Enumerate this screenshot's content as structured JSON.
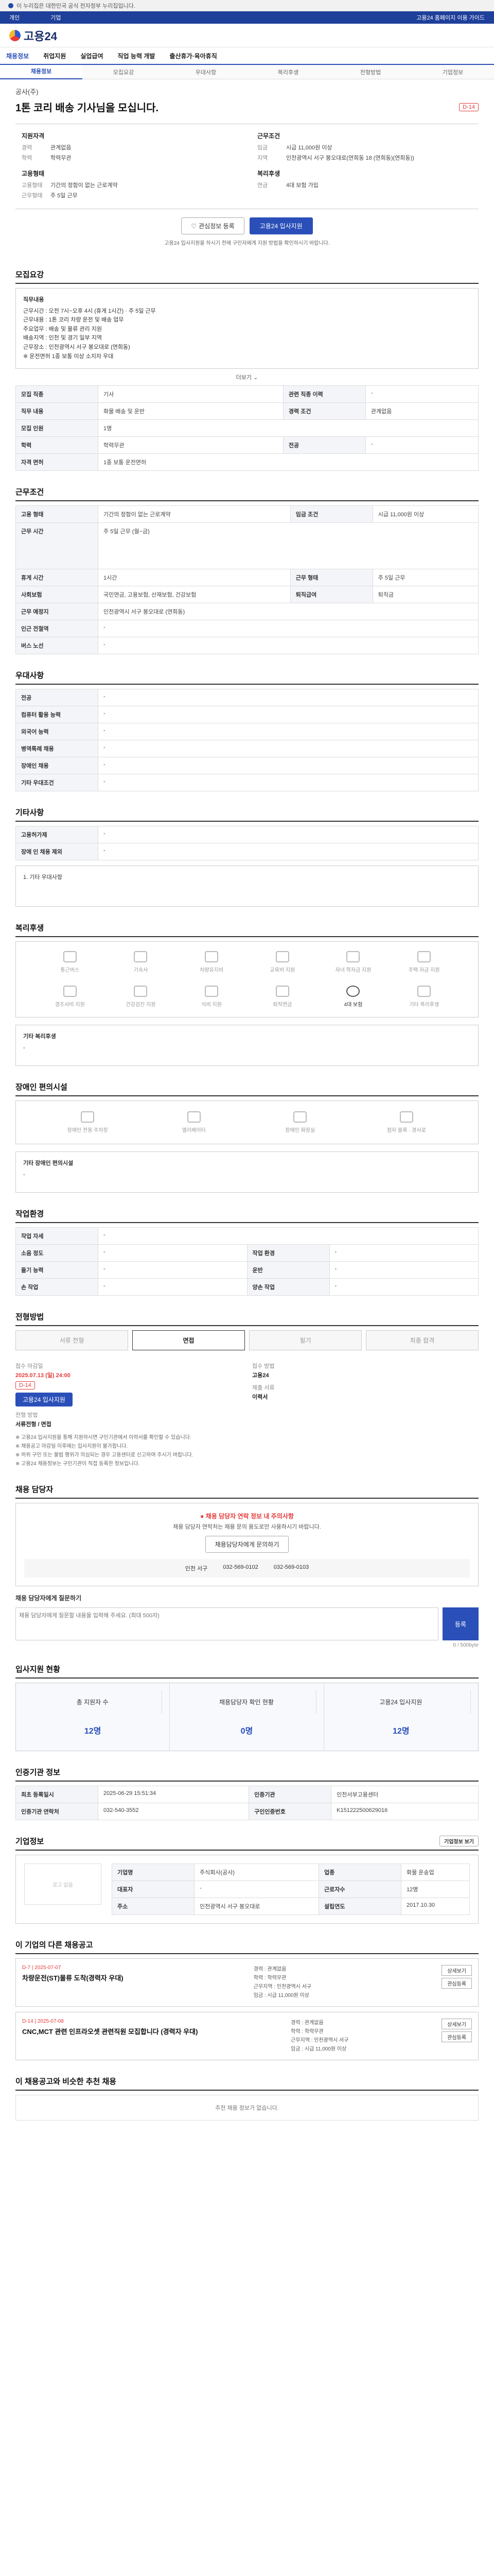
{
  "banner": {
    "text": "이 누리집은 대한민국 공식 전자정부 누리집입니다."
  },
  "topbar": {
    "left": [
      "개인",
      "기업"
    ],
    "right": "고용24 홈페이지 이용 가이드"
  },
  "header": {
    "logo": "고용24"
  },
  "gnb": [
    "채용정보",
    "취업지원",
    "실업급여",
    "직업 능력 개발",
    "출산휴가·육아휴직"
  ],
  "subtabs": [
    "채용정보",
    "모집요강",
    "우대사항",
    "복리후생",
    "전형방법",
    "기업정보"
  ],
  "job": {
    "company": "공사(주)",
    "title": "1톤 코리 배송 기사님을 모십니다.",
    "dday": "D-14",
    "summary": [
      {
        "head": "지원자격",
        "rows": [
          [
            "경력",
            "관계없음"
          ],
          [
            "학력",
            "학력무관"
          ]
        ]
      },
      {
        "head": "근무조건",
        "rows": [
          [
            "임금",
            "시급 11,000원 이상"
          ],
          [
            "지역",
            "인천광역시 서구 봉오대로(연희동 18 (연희동)(연희동))"
          ]
        ]
      },
      {
        "head": "고용형태",
        "rows": [
          [
            "고용형태",
            "기간의 정함이 없는 근로계약"
          ],
          [
            "근무형태",
            "주 5일 근무"
          ]
        ]
      },
      {
        "head": "복리후생",
        "rows": [
          [
            "연금",
            "4대 보험 가입"
          ]
        ]
      }
    ],
    "btn_scrap": "관심정보 등록",
    "btn_apply": "고용24 입사지원",
    "notice": "고용24 입사지원을 하시기 전에 구인자에게 지원 방법을 확인하시기 바랍니다."
  },
  "recruit": {
    "title": "모집요강",
    "desc_title": "직무내용",
    "desc": [
      "근무시간 : 오전 7시~오후 4시 (휴게 1시간) · 주 5일 근무",
      "근무내용 : 1톤 코리 차량 운전 및 배송 업무",
      "주요업무 : 배송 및 물류 관리 지원",
      "배송지역 : 인천 및 경기 일부 지역",
      "근무장소 : 인천광역시 서구 봉오대로 (연희동)",
      "※ 운전면허 1종 보통 이상 소지자 우대"
    ],
    "more": "더보기",
    "rows": [
      [
        "모집 직종",
        "기사",
        "관련 직종 이력",
        "-"
      ],
      [
        "직무 내용",
        "화물 배송 및 운반",
        "경력 조건",
        "관계없음"
      ],
      [
        "모집 인원",
        "1명",
        "",
        ""
      ],
      [
        "학력",
        "학력무관",
        "전공",
        "-"
      ],
      [
        "자격 면허",
        "1종 보통 운전면허",
        "",
        ""
      ]
    ]
  },
  "conditions": {
    "title": "근무조건",
    "rows": [
      [
        "고용 형태",
        "기간의 정함이 없는 근로계약",
        "임금 조건",
        "시급 11,000원 이상"
      ],
      [
        "근무 시간",
        "주 5일 근무 (월~금)",
        "",
        ""
      ],
      [
        "휴게 시간",
        "1시간",
        "근무 형태",
        "주 5일 근무"
      ],
      [
        "사회보험",
        "국민연금, 고용보험, 산재보험, 건강보험",
        "퇴직급여",
        "퇴직금"
      ],
      [
        "근무 예정지",
        "인천광역시 서구 봉오대로 (연희동)",
        "",
        ""
      ],
      [
        "인근 전철역",
        "-",
        "",
        ""
      ],
      [
        "버스 노선",
        "-",
        "",
        ""
      ]
    ]
  },
  "preferred": {
    "title": "우대사항",
    "rows": [
      [
        "전공",
        "-"
      ],
      [
        "컴퓨터 활용 능력",
        "-"
      ],
      [
        "외국어 능력",
        "-"
      ],
      [
        "병역특례 채용",
        "-"
      ],
      [
        "장애인 채용",
        "-"
      ],
      [
        "기타 우대조건",
        "-"
      ]
    ]
  },
  "etc": {
    "title": "기타사항",
    "rows": [
      [
        "고용허가제",
        "-"
      ],
      [
        "장애 인 채용 제외",
        "-"
      ]
    ]
  },
  "welfare": {
    "title": "복리후생",
    "icons": [
      "통근버스",
      "기숙사",
      "차량유지비",
      "교육비 지원",
      "자녀 학자금 지원",
      "주택 자금 지원",
      "경조사비 지원",
      "건강검진 지원",
      "식비 지원",
      "퇴직연금",
      "4대 보험",
      "기타 복리후생"
    ],
    "active": [
      10
    ],
    "note_head": "기타 복리후생",
    "note": "-"
  },
  "disabled": {
    "title": "장애인 편의시설",
    "icons": [
      "장애인 전용 주차장",
      "엘리베이터",
      "장애인 화장실",
      "점자 블록 · 경사로"
    ],
    "note_head": "기타 장애인 편의시설",
    "note": "-"
  },
  "worksite": {
    "title": "작업환경",
    "rows": [
      [
        "작업 자세",
        "-",
        "",
        ""
      ],
      [
        "소음 정도",
        "-",
        "작업 환경",
        "-"
      ],
      [
        "들기 능력",
        "-",
        "운반",
        "-"
      ],
      [
        "손 작업",
        "-",
        "양손 작업",
        "-"
      ]
    ]
  },
  "method": {
    "title": "전형방법",
    "steps": [
      "서류 전형",
      "면접",
      "필기",
      "최종 합격"
    ],
    "active_step": 1,
    "left": [
      [
        "접수 마감일",
        "2025.07.13 (일) 24:00"
      ],
      [
        "전형 방법",
        "서류전형 / 면접"
      ]
    ],
    "right": [
      [
        "접수 방법",
        "고용24"
      ],
      [
        "제출 서류",
        "이력서"
      ]
    ],
    "notes": [
      "※ 고용24 입사지원을 통해 지원하시면 구인기관에서 이력서를 확인할 수 있습니다.",
      "※ 채용공고 마감일 이후에는 입사지원이 불가합니다.",
      "※ 허위 구인 또는 불법 행위가 의심되는 경우 고용센터로 신고하여 주시기 바랍니다.",
      "※ 고용24 채용정보는 구인기관이 직접 등록한 정보입니다."
    ]
  },
  "contact": {
    "title": "채용 담당자",
    "warn": "채용 담당자 연락 정보 내 주의사항",
    "desc": "채용 담당자 연락처는 채용 문의 용도로만 사용하시기 바랍니다.",
    "btn": "채용담당자에게 문의하기",
    "person": "인천 서구",
    "phone": "032-569-0102",
    "fax": "032-569-0103"
  },
  "qa": {
    "title": "채용 담당자에게 질문하기",
    "placeholder": "채용 담당자에게 질문할 내용을 입력해 주세요. (최대 500자)",
    "btn": "등록",
    "counter": "0 / 500byte"
  },
  "status": {
    "title": "입사지원 현황",
    "items": [
      [
        "총 지원자 수",
        "12명"
      ],
      [
        "채용담당자 확인 현황",
        "0명"
      ],
      [
        "고용24 입사지원",
        "12명"
      ]
    ]
  },
  "info": {
    "title": "인증기관 정보",
    "rows": [
      [
        "최초 등록일시",
        "2025-06-29 15:51:34",
        "인증기관",
        "인천서부고용센터"
      ],
      [
        "인증기관 연락처",
        "032-540-3552",
        "구인인증번호",
        "K151222500629016"
      ]
    ]
  },
  "company": {
    "title": "기업정보",
    "logo_note": "로고 없음",
    "rows": [
      [
        "기업명",
        "주식회사(공사)",
        "업종",
        "화물 운송업"
      ],
      [
        "대표자",
        "-",
        "근로자수",
        "12명"
      ],
      [
        "주소",
        "인천광역시 서구 봉오대로",
        "설립연도",
        "2017.10.30"
      ]
    ],
    "btn": "기업정보 보기"
  },
  "related": {
    "title": "이 기업의 다른 채용공고",
    "items": [
      {
        "tag": "D-7  |  2025-07-07",
        "title": "차량운전(ST)물류 도착(경력자 우대)",
        "meta": [
          "경력 : 관계없음",
          "학력 : 학력무관",
          "근무지역 : 인천광역시 서구",
          "임금 : 시급 11,000원 이상"
        ]
      },
      {
        "tag": "D-14  |  2025-07-08",
        "title": "CNC,MCT 관련 인프라오셋 관련직원 모집합니다 (경력자 우대)",
        "meta": [
          "경력 : 관계없음",
          "학력 : 학력무관",
          "근무지역 : 인천광역시 서구",
          "임금 : 시급 11,000원 이상"
        ]
      }
    ],
    "btn_detail": "상세보기",
    "btn_scrap": "관심등록"
  },
  "recommend": {
    "title": "이 채용공고와 비슷한 추천 채용",
    "empty": "추천 채용 정보가 없습니다."
  },
  "colors": {
    "primary": "#2a4fb8",
    "danger": "#e53b3b"
  }
}
